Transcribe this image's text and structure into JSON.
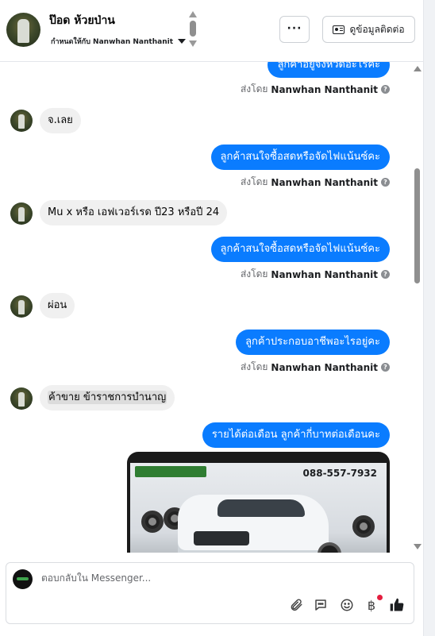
{
  "header": {
    "contact_name": "ป๊อด ห้วยป่าน",
    "assigned_to": "กำหนดให้กับ Nanwhan Nanthanit",
    "more_label": "···",
    "contact_info_label": "ดูข้อมูลติดต่อ"
  },
  "messages": {
    "m1": "ลูกค้าอยู่จังหวัดอะไรคะ",
    "m2": "จ.เลย",
    "m3": "ลูกค้าสนใจซื้อสดหรือจัดไฟแน้นซ์คะ",
    "m4": "Mu x หรือ เอฟเวอร์เรด ปี23 หรือปี 24",
    "m5": "ลูกค้าสนใจซื้อสดหรือจัดไฟแน้นซ์คะ",
    "m6": "ผ่อน",
    "m7": "ลูกค้าประกอบอาชีพอะไรอยู่คะ",
    "m8": "ค้าขาย ข้าราชการบำนาญ",
    "m9": "รายได้ต่อเดือน ลูกค้ากี่บาทต่อเดือนคะ"
  },
  "sent_by": {
    "prefix": "ส่งโดย",
    "name": "Nanwhan Nanthanit"
  },
  "attachment": {
    "phone": "088-557-7932"
  },
  "composer": {
    "placeholder": "ตอบกลับใน Messenger..."
  },
  "icons": {
    "attach": "paperclip-icon",
    "chat": "message-bubble-icon",
    "emoji": "smiley-icon",
    "currency": "baht-icon",
    "like": "thumbs-up-icon"
  },
  "colors": {
    "outgoing_bubble": "#0a7cff",
    "incoming_bubble": "#f0f0f0",
    "notification_dot": "#e41e3f"
  }
}
